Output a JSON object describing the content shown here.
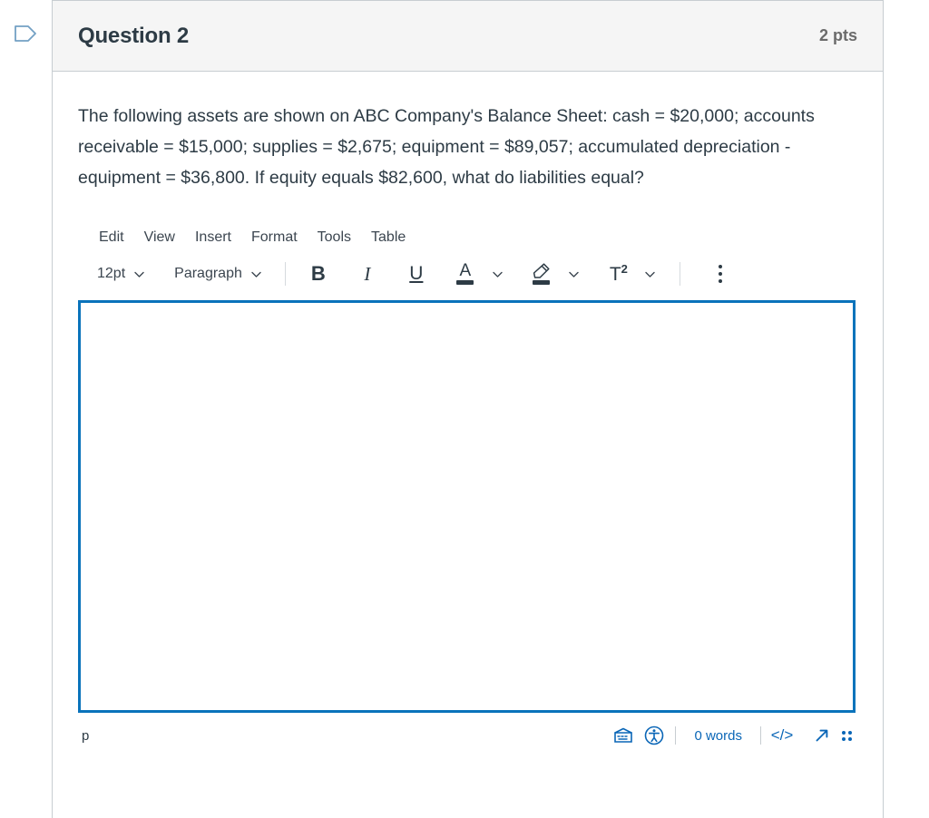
{
  "gutter": {
    "icon": "tag-outline-icon"
  },
  "question": {
    "title": "Question 2",
    "points": "2 pts",
    "text": "The following assets are shown on ABC Company's Balance Sheet: cash = $20,000; accounts receivable = $15,000; supplies = $2,675; equipment = $89,057; accumulated depreciation - equipment = $36,800. If equity equals $82,600, what do liabilities equal?"
  },
  "editor": {
    "menubar": [
      {
        "label": "Edit"
      },
      {
        "label": "View"
      },
      {
        "label": "Insert"
      },
      {
        "label": "Format"
      },
      {
        "label": "Tools"
      },
      {
        "label": "Table"
      }
    ],
    "toolbar": {
      "font_size": "12pt",
      "block_format": "Paragraph",
      "bold": "B",
      "italic": "I",
      "underline": "U",
      "text_color": "A",
      "highlight": "highlighter-icon",
      "superscript_glyph": "T",
      "superscript_exponent": "2",
      "more_options": "kebab-menu-icon"
    },
    "content": "",
    "placeholder": "",
    "statusbar": {
      "path": "p",
      "word_count": "0 words",
      "accessibility_icon": "accessibility-checker-icon",
      "keyboard_icon": "keyboard-icon",
      "html_editor": "</>",
      "fullscreen_icon": "expand-arrow-icon",
      "resize_handle": "resize-grip-icon"
    }
  },
  "colors": {
    "accent_blue": "#0a73bb",
    "link_blue": "#0a66b7",
    "header_bg": "#f5f5f5",
    "border": "#c7cdd1",
    "text": "#2d3b45",
    "muted": "#6b6b6b"
  }
}
